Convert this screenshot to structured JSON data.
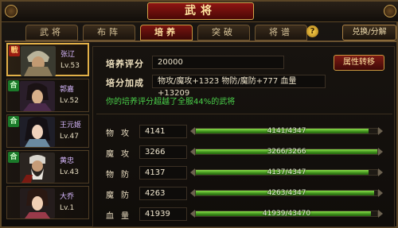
{
  "window": {
    "title": "武将"
  },
  "tabs": [
    {
      "label": "武将",
      "active": false
    },
    {
      "label": "布阵",
      "active": false
    },
    {
      "label": "培养",
      "active": true
    },
    {
      "label": "突破",
      "active": false
    },
    {
      "label": "将谱",
      "active": false
    }
  ],
  "help_icon": "?",
  "exchange_button": "兑换/分解",
  "roster": [
    {
      "badge": "戰",
      "badge_color": "red",
      "name": "张辽",
      "level": "Lv.53",
      "selected": true,
      "portrait": "armored-general-portrait"
    },
    {
      "badge": "合",
      "badge_color": "green",
      "name": "郭嘉",
      "level": "Lv.52",
      "selected": false,
      "portrait": "strategist-portrait"
    },
    {
      "badge": "合",
      "badge_color": "green",
      "name": "王元姬",
      "level": "Lv.47",
      "selected": false,
      "portrait": "lady-portrait"
    },
    {
      "badge": "合",
      "badge_color": "green",
      "name": "黄忠",
      "level": "Lv.43",
      "selected": false,
      "portrait": "old-general-portrait"
    },
    {
      "badge": "",
      "badge_color": "none",
      "name": "大乔",
      "level": "Lv.1",
      "selected": false,
      "portrait": "young-lady-portrait"
    }
  ],
  "cultivation": {
    "score_label": "培养评分",
    "score_value": "20000",
    "bonus_label": "培分加成",
    "bonus_value": "物攻/魔攻+1323 物防/魔防+777 血量+13209",
    "attr_transfer_button": "属性转移",
    "note": "你的培养评分超越了全服44%的武将"
  },
  "stats": [
    {
      "label": "物攻",
      "value": "4141",
      "bar_text": "4141/4347",
      "current": 4141,
      "max": 4347
    },
    {
      "label": "魔攻",
      "value": "3266",
      "bar_text": "3266/3266",
      "current": 3266,
      "max": 3266
    },
    {
      "label": "物防",
      "value": "4137",
      "bar_text": "4137/4347",
      "current": 4137,
      "max": 4347
    },
    {
      "label": "魔防",
      "value": "4263",
      "bar_text": "4263/4347",
      "current": 4263,
      "max": 4347
    },
    {
      "label": "血量",
      "value": "41939",
      "bar_text": "41939/43470",
      "current": 41939,
      "max": 43470
    }
  ],
  "colors": {
    "accent_red": "#7a1410",
    "gold": "#c9963f",
    "bar_green": "#3d8e1c",
    "note_green": "#4ad04a"
  }
}
